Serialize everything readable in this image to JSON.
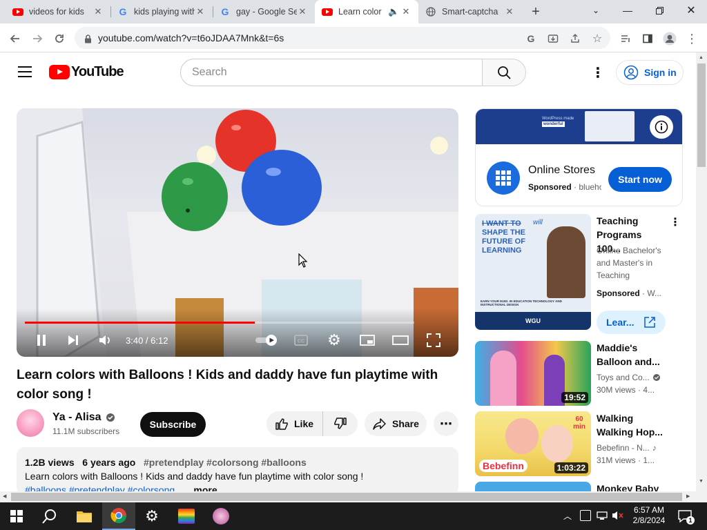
{
  "browser": {
    "tabs": [
      {
        "title": "videos for kids",
        "favicon": "youtube-icon",
        "active": false
      },
      {
        "title": "kids playing with",
        "favicon": "google-icon",
        "active": false
      },
      {
        "title": "gay - Google Se",
        "favicon": "google-icon",
        "active": false
      },
      {
        "title": "Learn color",
        "favicon": "youtube-icon",
        "active": true
      },
      {
        "title": "Smart-captcha",
        "favicon": "globe-icon",
        "active": false
      }
    ],
    "new_tab": "+",
    "url": "youtube.com/watch?v=t6oJDAA7Mnk&t=6s"
  },
  "youtube": {
    "logo_text": "YouTube",
    "search_placeholder": "Search",
    "sign_in": "Sign in"
  },
  "player": {
    "time": "3:40 / 6:12",
    "progress": 0.59
  },
  "video": {
    "title": "Learn colors with Balloons ! Kids and daddy have fun playtime with color song !",
    "channel": "Ya - Alisa",
    "subscribers": "11.1M subscribers",
    "subscribe_label": "Subscribe",
    "like_label": "Like",
    "share_label": "Share",
    "views": "1.2B views",
    "age": "6 years ago",
    "hashtags_top": "#pretendplay #colorsong #balloons",
    "description": "Learn colors with Balloons ! Kids and daddy have fun playtime with color song !",
    "hashtags_bottom": "#balloons #pretendplay #colorsong",
    "more": "...more"
  },
  "ad": {
    "banner_line1": "WordPress made",
    "banner_line2": "wonderful",
    "name": "Online Stores",
    "sponsored": "Sponsored",
    "advertiser": "bluehost",
    "cta": "Start now"
  },
  "recommendations": [
    {
      "title": "Teaching Programs 100...",
      "meta1": "Online Bachelor's and Master's in Teaching",
      "meta2": "Sponsored",
      "meta3": "W...",
      "cta": "Lear...",
      "thumb_lines": [
        "I WANT TO",
        "SHAPE THE",
        "FUTURE OF",
        "LEARNING"
      ],
      "thumb_will": "will",
      "thumb_small": "EARN YOUR M.ED. IN EDUCATION TECHNOLOGY AND INSTRUCTIONAL DESIGN",
      "thumb_logo": "WGU"
    },
    {
      "title": "Maddie's Balloon and...",
      "channel": "Toys and Co...",
      "stats": "30M views · 4...",
      "duration": "19:52"
    },
    {
      "title": "Walking Walking Hop...",
      "channel": "Bebefinn - N...",
      "stats": "31M views · 1...",
      "duration": "1:03:22",
      "thumb_brand": "Bebefinn",
      "thumb_badge": "60 min"
    },
    {
      "title": "Monkey Baby"
    }
  ],
  "taskbar": {
    "time": "6:57 AM",
    "date": "2/8/2024",
    "notification_count": "1"
  }
}
